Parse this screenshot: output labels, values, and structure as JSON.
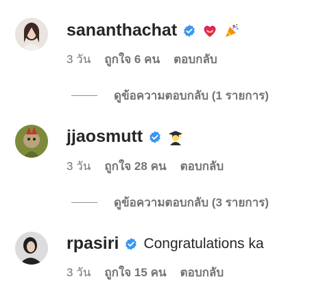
{
  "comments": [
    {
      "username": "sananthachat",
      "verified": true,
      "text": "",
      "emojis": [
        "heart-with-ribbon-icon",
        "party-popper-icon"
      ],
      "time": "3 วัน",
      "likes": "ถูกใจ 6 คน",
      "reply": "ตอบกลับ",
      "view_replies": "ดูข้อความตอบกลับ (1 รายการ)"
    },
    {
      "username": "jjaosmutt",
      "verified": true,
      "text": "",
      "emojis": [
        "graduate-icon"
      ],
      "time": "3 วัน",
      "likes": "ถูกใจ 28 คน",
      "reply": "ตอบกลับ",
      "view_replies": "ดูข้อความตอบกลับ (3 รายการ)"
    },
    {
      "username": "rpasiri",
      "verified": true,
      "text": "Congratulations ka",
      "emojis": [],
      "time": "3 วัน",
      "likes": "ถูกใจ 15 คน",
      "reply": "ตอบกลับ",
      "view_replies": ""
    }
  ],
  "colors": {
    "verified": "#3897f0",
    "secondary_text": "#737373",
    "primary_text": "#262626"
  }
}
